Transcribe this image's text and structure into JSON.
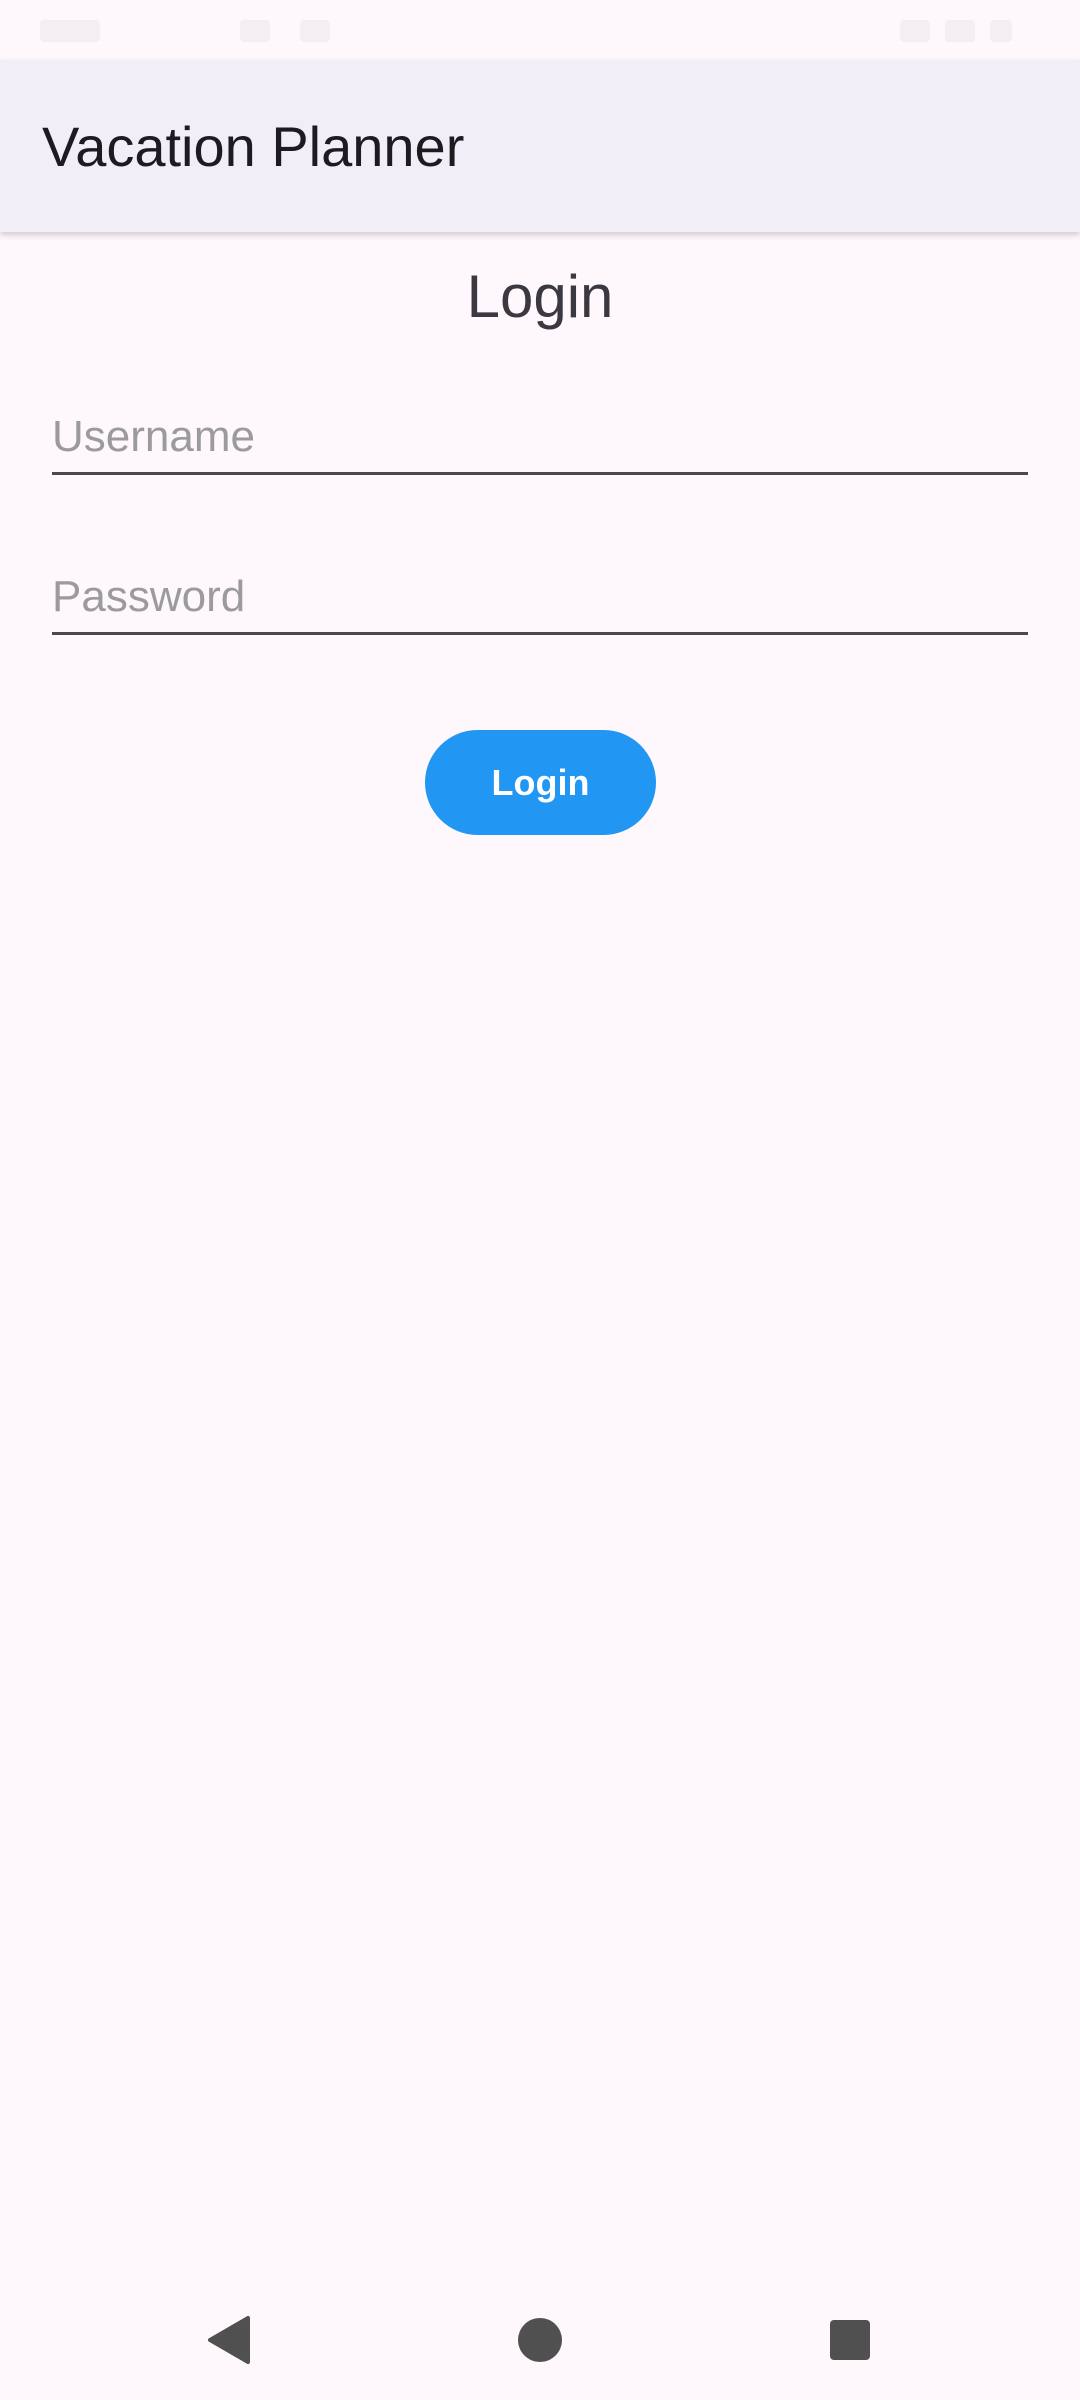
{
  "app_bar": {
    "title": "Vacation Planner"
  },
  "page": {
    "title": "Login"
  },
  "form": {
    "username": {
      "placeholder": "Username",
      "value": ""
    },
    "password": {
      "placeholder": "Password",
      "value": ""
    },
    "login_label": "Login"
  },
  "colors": {
    "accent": "#2196f3",
    "app_bar_bg": "#f2eef7",
    "background": "#fef8fc"
  },
  "nav_bar": {
    "icons": [
      "back-triangle-icon",
      "home-circle-icon",
      "recents-square-icon"
    ]
  }
}
